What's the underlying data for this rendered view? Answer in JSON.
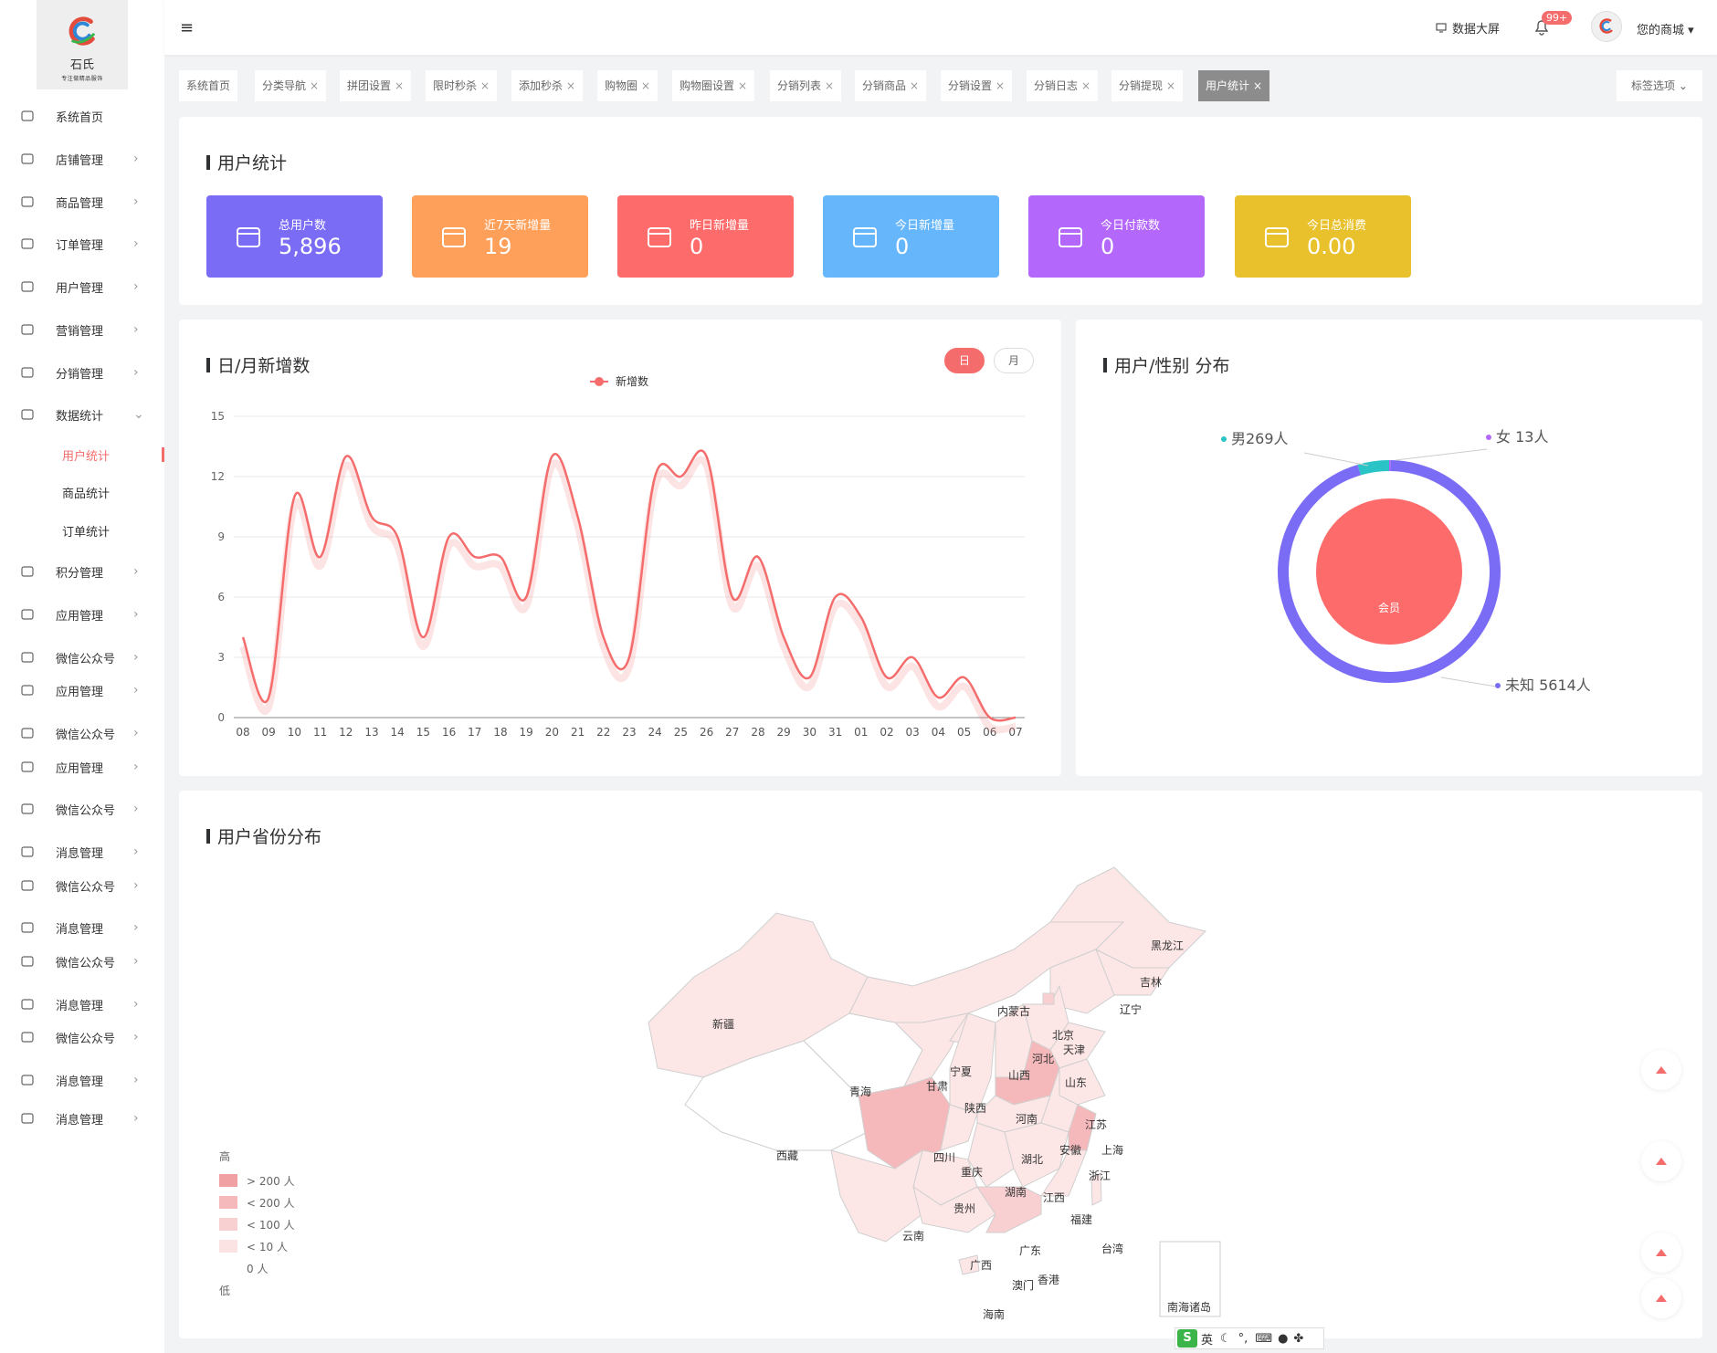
{
  "brand": {
    "name": "石氏",
    "slogan": "专注做精品服饰"
  },
  "sidebar": {
    "items": [
      {
        "label": "系统首页",
        "icon": "home-icon"
      },
      {
        "label": "店铺管理",
        "icon": "store-icon"
      },
      {
        "label": "商品管理",
        "icon": "goods-icon"
      },
      {
        "label": "订单管理",
        "icon": "order-icon"
      },
      {
        "label": "用户管理",
        "icon": "user-icon"
      },
      {
        "label": "营销管理",
        "icon": "marketing-icon"
      },
      {
        "label": "分销管理",
        "icon": "distribution-icon"
      },
      {
        "label": "数据统计",
        "icon": "chart-icon"
      },
      {
        "label": "用户统计",
        "icon": ""
      },
      {
        "label": "商品统计",
        "icon": ""
      },
      {
        "label": "订单统计",
        "icon": ""
      },
      {
        "label": "积分管理",
        "icon": "points-icon"
      },
      {
        "label": "应用管理",
        "icon": "app-icon"
      },
      {
        "label": "微信公众号",
        "icon": "wechat-icon"
      },
      {
        "label": "应用管理",
        "icon": "app-icon"
      },
      {
        "label": "微信公众号",
        "icon": "wechat-icon"
      },
      {
        "label": "应用管理",
        "icon": "app-icon"
      },
      {
        "label": "微信公众号",
        "icon": "wechat-icon"
      },
      {
        "label": "消息管理",
        "icon": "message-icon"
      },
      {
        "label": "微信公众号",
        "icon": "wechat-icon"
      },
      {
        "label": "消息管理",
        "icon": "message-icon"
      },
      {
        "label": "微信公众号",
        "icon": "wechat-icon"
      },
      {
        "label": "消息管理",
        "icon": "message-icon"
      },
      {
        "label": "微信公众号",
        "icon": "wechat-icon"
      },
      {
        "label": "消息管理",
        "icon": "message-icon"
      },
      {
        "label": "消息管理",
        "icon": "message-icon"
      }
    ]
  },
  "header": {
    "data_screen": "数据大屏",
    "badge": "99+",
    "user_name": "您的商城"
  },
  "tags": {
    "items": [
      "系统首页",
      "分类导航",
      "拼团设置",
      "限时秒杀",
      "添加秒杀",
      "购物圈",
      "购物圈设置",
      "分销列表",
      "分销商品",
      "分销设置",
      "分销日志",
      "分销提现",
      "用户统计"
    ],
    "active": "用户统计",
    "options_label": "标签选项"
  },
  "stats": {
    "title": "用户统计",
    "cards": [
      {
        "label": "总用户数",
        "value": "5,896",
        "color": "#7b6cf6",
        "icon": "users-icon"
      },
      {
        "label": "近7天新增量",
        "value": "19",
        "color": "#ffa05a",
        "icon": "calendar-7-icon"
      },
      {
        "label": "昨日新增量",
        "value": "0",
        "color": "#fd6b6b",
        "icon": "calendar-yesterday-icon"
      },
      {
        "label": "今日新增量",
        "value": "0",
        "color": "#65b6fb",
        "icon": "calendar-today-icon"
      },
      {
        "label": "今日付款数",
        "value": "0",
        "color": "#b467fb",
        "icon": "payment-icon"
      },
      {
        "label": "今日总消费",
        "value": "0.00",
        "color": "#e8c12c",
        "icon": "coins-icon"
      }
    ]
  },
  "line_panel": {
    "title": "日/月新增数",
    "toggle_day": "日",
    "toggle_month": "月"
  },
  "pie_panel": {
    "title": "用户/性别 分布"
  },
  "map_panel": {
    "title": "用户省份分布",
    "legend": {
      "high": "高",
      "low": "低",
      "items": [
        "> 200 人",
        "< 200 人",
        "< 100 人",
        "< 10 人",
        "0 人"
      ],
      "colors": [
        "#f0a0a3",
        "#f6b9bb",
        "#f9d0d1",
        "#fbe3e3",
        "#ffffff"
      ]
    },
    "provinces": [
      "黑龙江",
      "吉林",
      "辽宁",
      "内蒙古",
      "北京",
      "天津",
      "河北",
      "山西",
      "山东",
      "宁夏",
      "甘肃",
      "新疆",
      "青海",
      "陕西",
      "河南",
      "江苏",
      "安徽",
      "上海",
      "西藏",
      "四川",
      "重庆",
      "湖北",
      "浙江",
      "湖南",
      "江西",
      "贵州",
      "云南",
      "福建",
      "台湾",
      "广东",
      "广西",
      "香港",
      "澳门",
      "海南",
      "南海诸岛"
    ]
  },
  "ime": {
    "lang": "英"
  },
  "chart_data": [
    {
      "type": "line",
      "legend": [
        "新增数"
      ],
      "x": [
        "08",
        "09",
        "10",
        "11",
        "12",
        "13",
        "14",
        "15",
        "16",
        "17",
        "18",
        "19",
        "20",
        "21",
        "22",
        "23",
        "24",
        "25",
        "26",
        "27",
        "28",
        "29",
        "30",
        "31",
        "01",
        "02",
        "03",
        "04",
        "05",
        "06",
        "07"
      ],
      "series": [
        {
          "name": "新增数",
          "values": [
            4,
            1,
            11,
            8,
            13,
            10,
            9,
            4,
            9,
            8,
            8,
            6,
            13,
            10,
            4,
            3,
            12,
            12,
            13,
            6,
            8,
            4,
            2,
            6,
            5,
            2,
            3,
            1,
            2,
            0,
            0
          ]
        }
      ],
      "ylim": [
        0,
        15
      ],
      "yticks": [
        0,
        3,
        6,
        9,
        12,
        15
      ],
      "color": "#f56c6c",
      "smooth": true,
      "legend_position": "top-center"
    },
    {
      "type": "pie",
      "slices": [
        {
          "label": "男269人",
          "value": 269,
          "color": "#2ac4c6"
        },
        {
          "label": "女 13人",
          "value": 13,
          "color": "#b467fb"
        },
        {
          "label": "未知 5614人",
          "value": 5614,
          "color": "#7b6cf6"
        }
      ],
      "inner": {
        "label": "会员",
        "color": "#fd6b6b"
      }
    }
  ]
}
